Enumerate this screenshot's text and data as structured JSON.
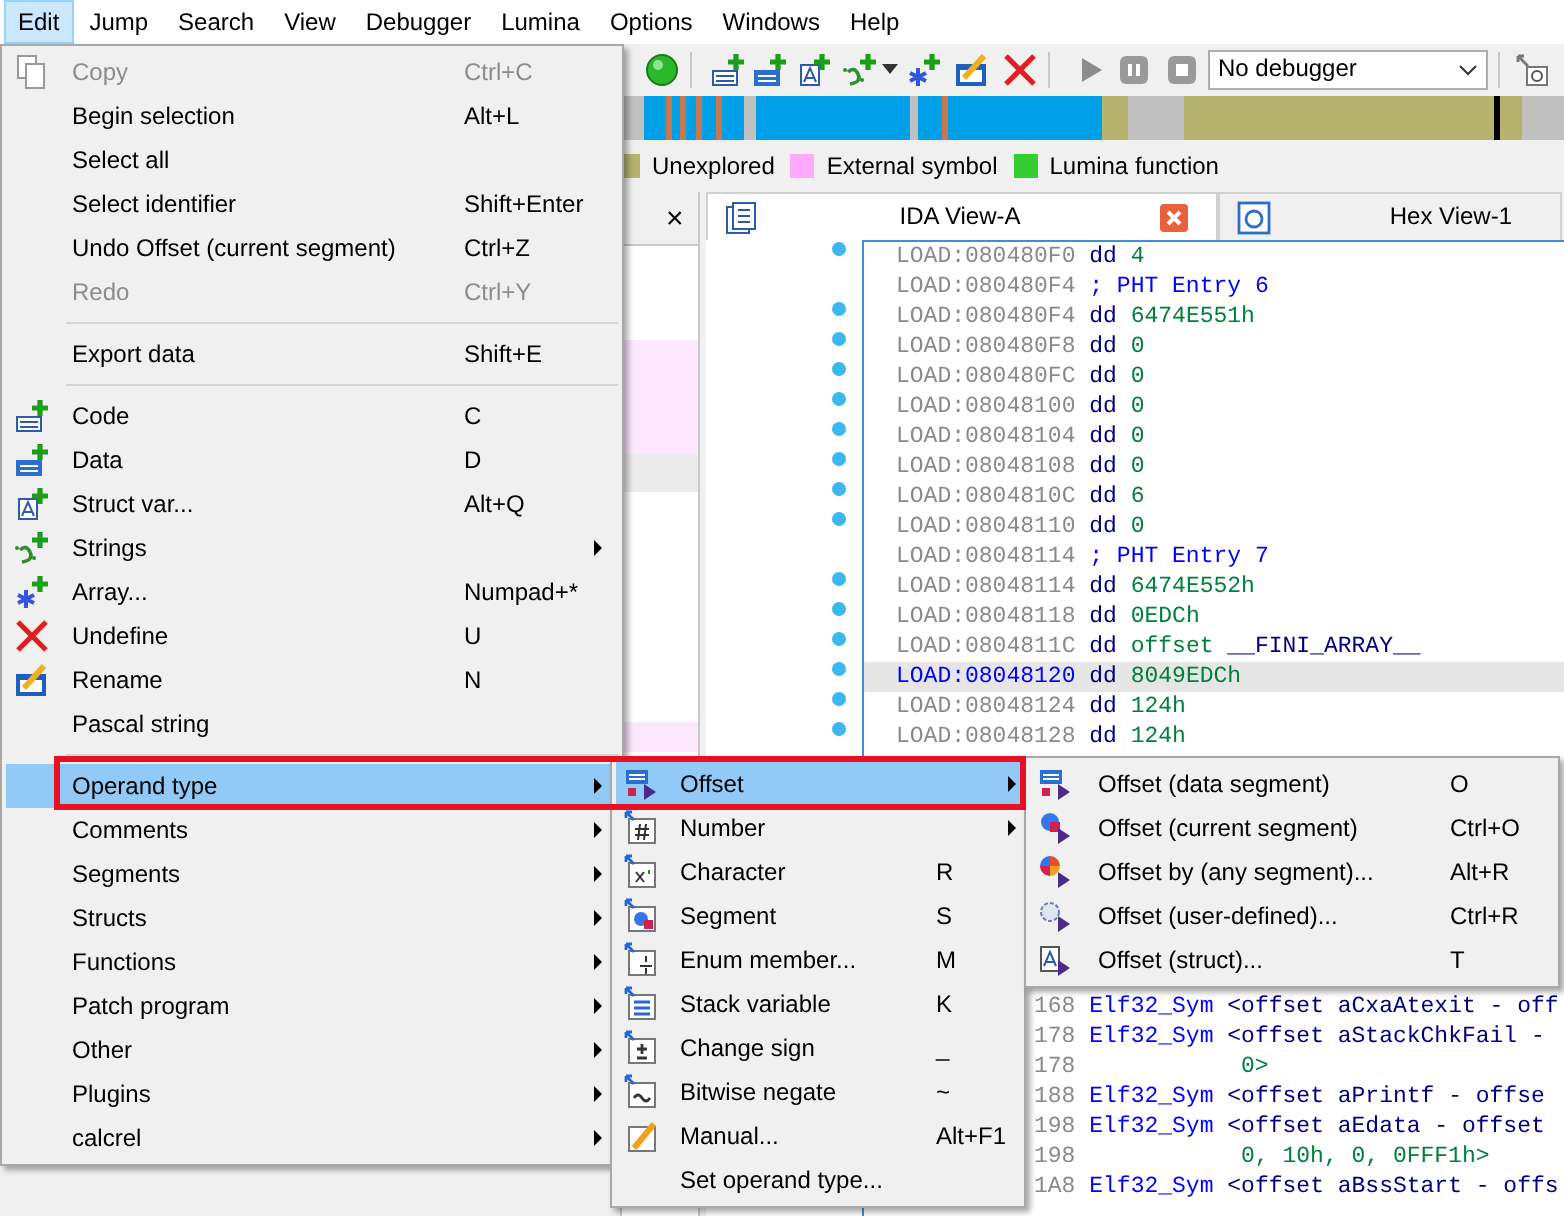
{
  "menu_bar": [
    {
      "label": "Edit",
      "selected": true
    },
    {
      "label": "Jump",
      "selected": false
    },
    {
      "label": "Search",
      "selected": false
    },
    {
      "label": "View",
      "selected": false
    },
    {
      "label": "Debugger",
      "selected": false
    },
    {
      "label": "Lumina",
      "selected": false
    },
    {
      "label": "Options",
      "selected": false
    },
    {
      "label": "Windows",
      "selected": false
    },
    {
      "label": "Help",
      "selected": false
    }
  ],
  "toolbar": {
    "debugger": "No debugger"
  },
  "legend": [
    {
      "label": "Unexplored",
      "color": "#b5b36e"
    },
    {
      "label": "External symbol",
      "color": "#ffaaff"
    },
    {
      "label": "Lumina function",
      "color": "#33cc33"
    }
  ],
  "left_panel": {
    "close": "×"
  },
  "tabs": [
    {
      "label": "IDA View-A",
      "selected": true
    },
    {
      "label": "Hex View-1",
      "selected": false
    }
  ],
  "listing": [
    {
      "kind": "data",
      "address": "LOAD:080480F0",
      "mnemonic": "dd",
      "operand": "4",
      "dot": true,
      "selected": false
    },
    {
      "kind": "comment",
      "address": "LOAD:080480F4",
      "comment": "; PHT Entry 6",
      "dot": false,
      "selected": false
    },
    {
      "kind": "data",
      "address": "LOAD:080480F4",
      "mnemonic": "dd",
      "operand": "6474E551h",
      "dot": true,
      "selected": false
    },
    {
      "kind": "data",
      "address": "LOAD:080480F8",
      "mnemonic": "dd",
      "operand": "0",
      "dot": true,
      "selected": false
    },
    {
      "kind": "data",
      "address": "LOAD:080480FC",
      "mnemonic": "dd",
      "operand": "0",
      "dot": true,
      "selected": false
    },
    {
      "kind": "data",
      "address": "LOAD:08048100",
      "mnemonic": "dd",
      "operand": "0",
      "dot": true,
      "selected": false
    },
    {
      "kind": "data",
      "address": "LOAD:08048104",
      "mnemonic": "dd",
      "operand": "0",
      "dot": true,
      "selected": false
    },
    {
      "kind": "data",
      "address": "LOAD:08048108",
      "mnemonic": "dd",
      "operand": "0",
      "dot": true,
      "selected": false
    },
    {
      "kind": "data",
      "address": "LOAD:0804810C",
      "mnemonic": "dd",
      "operand": "6",
      "dot": true,
      "selected": false
    },
    {
      "kind": "data",
      "address": "LOAD:08048110",
      "mnemonic": "dd",
      "operand": "0",
      "dot": true,
      "selected": false
    },
    {
      "kind": "comment",
      "address": "LOAD:08048114",
      "comment": "; PHT Entry 7",
      "dot": false,
      "selected": false
    },
    {
      "kind": "data",
      "address": "LOAD:08048114",
      "mnemonic": "dd",
      "operand": "6474E552h",
      "dot": true,
      "selected": false
    },
    {
      "kind": "data",
      "address": "LOAD:08048118",
      "mnemonic": "dd",
      "operand": "0EDCh",
      "dot": true,
      "selected": false
    },
    {
      "kind": "data",
      "address": "LOAD:0804811C",
      "mnemonic": "dd",
      "operand": "offset",
      "symbol": "__FINI_ARRAY__",
      "dot": true,
      "selected": false
    },
    {
      "kind": "data",
      "address": "LOAD:08048120",
      "mnemonic": "dd",
      "operand": "8049EDCh",
      "dot": true,
      "selected": true
    },
    {
      "kind": "data",
      "address": "LOAD:08048124",
      "mnemonic": "dd",
      "operand": "124h",
      "dot": true,
      "selected": false
    },
    {
      "kind": "data",
      "address": "LOAD:08048128",
      "mnemonic": "dd",
      "operand": "124h",
      "dot": true,
      "selected": false
    }
  ],
  "listing_tail": [
    {
      "kind": "struct",
      "address": "168",
      "type": "Elf32_Sym",
      "operand": "<offset aCxaAtexit - off"
    },
    {
      "kind": "struct",
      "address": "178",
      "type": "Elf32_Sym",
      "operand": "<offset aStackChkFail -"
    },
    {
      "kind": "continuation",
      "address": "178",
      "operand": "0>"
    },
    {
      "kind": "struct",
      "address": "188",
      "type": "Elf32_Sym",
      "operand": "<offset aPrintf - offse"
    },
    {
      "kind": "struct",
      "address": "198",
      "type": "Elf32_Sym",
      "operand": "<offset aEdata - offset"
    },
    {
      "kind": "continuation",
      "address": "198",
      "operand": "0, 10h, 0, 0FFF1h>"
    },
    {
      "kind": "struct",
      "address": "1A8",
      "type": "Elf32_Sym",
      "operand": "<offset aBssStart - offs"
    }
  ],
  "edit_menu": {
    "items": [
      {
        "kind": "item",
        "label": "Copy",
        "shortcut": "Ctrl+C",
        "disabled": true,
        "selected": false,
        "submenu": false
      },
      {
        "kind": "item",
        "label": "Begin selection",
        "shortcut": "Alt+L",
        "disabled": false,
        "selected": false,
        "submenu": false
      },
      {
        "kind": "item",
        "label": "Select all",
        "disabled": false,
        "selected": false,
        "submenu": false
      },
      {
        "kind": "item",
        "label": "Select identifier",
        "shortcut": "Shift+Enter",
        "disabled": false,
        "selected": false,
        "submenu": false
      },
      {
        "kind": "item",
        "label": "Undo Offset (current segment)",
        "shortcut": "Ctrl+Z",
        "disabled": false,
        "selected": false,
        "submenu": false
      },
      {
        "kind": "item",
        "label": "Redo",
        "shortcut": "Ctrl+Y",
        "disabled": true,
        "selected": false,
        "submenu": false
      },
      {
        "kind": "separator"
      },
      {
        "kind": "item",
        "label": "Export data",
        "shortcut": "Shift+E",
        "disabled": false,
        "selected": false,
        "submenu": false
      },
      {
        "kind": "separator"
      },
      {
        "kind": "item",
        "label": "Code",
        "shortcut": "C",
        "disabled": false,
        "selected": false,
        "submenu": false
      },
      {
        "kind": "item",
        "label": "Data",
        "shortcut": "D",
        "disabled": false,
        "selected": false,
        "submenu": false
      },
      {
        "kind": "item",
        "label": "Struct var...",
        "shortcut": "Alt+Q",
        "disabled": false,
        "selected": false,
        "submenu": false
      },
      {
        "kind": "item",
        "label": "Strings",
        "disabled": false,
        "selected": false,
        "submenu": true
      },
      {
        "kind": "item",
        "label": "Array...",
        "shortcut": "Numpad+*",
        "disabled": false,
        "selected": false,
        "submenu": false
      },
      {
        "kind": "item",
        "label": "Undefine",
        "shortcut": "U",
        "disabled": false,
        "selected": false,
        "submenu": false
      },
      {
        "kind": "item",
        "label": "Rename",
        "shortcut": "N",
        "disabled": false,
        "selected": false,
        "submenu": false
      },
      {
        "kind": "item",
        "label": "Pascal string",
        "disabled": false,
        "selected": false,
        "submenu": false
      },
      {
        "kind": "separator"
      },
      {
        "kind": "item",
        "label": "Operand type",
        "disabled": false,
        "selected": true,
        "submenu": true
      },
      {
        "kind": "item",
        "label": "Comments",
        "disabled": false,
        "selected": false,
        "submenu": true
      },
      {
        "kind": "item",
        "label": "Segments",
        "disabled": false,
        "selected": false,
        "submenu": true
      },
      {
        "kind": "item",
        "label": "Structs",
        "disabled": false,
        "selected": false,
        "submenu": true
      },
      {
        "kind": "item",
        "label": "Functions",
        "disabled": false,
        "selected": false,
        "submenu": true
      },
      {
        "kind": "item",
        "label": "Patch program",
        "disabled": false,
        "selected": false,
        "submenu": true
      },
      {
        "kind": "item",
        "label": "Other",
        "disabled": false,
        "selected": false,
        "submenu": true
      },
      {
        "kind": "item",
        "label": "Plugins",
        "disabled": false,
        "selected": false,
        "submenu": true
      },
      {
        "kind": "item",
        "label": "calcrel",
        "disabled": false,
        "selected": false,
        "submenu": true
      }
    ]
  },
  "operand_type_menu": {
    "items": [
      {
        "kind": "item",
        "label": "Offset",
        "disabled": false,
        "selected": true,
        "submenu": true
      },
      {
        "kind": "item",
        "label": "Number",
        "disabled": false,
        "selected": false,
        "submenu": true
      },
      {
        "kind": "item",
        "label": "Character",
        "shortcut": "R",
        "disabled": false,
        "selected": false,
        "submenu": false
      },
      {
        "kind": "item",
        "label": "Segment",
        "shortcut": "S",
        "disabled": false,
        "selected": false,
        "submenu": false
      },
      {
        "kind": "item",
        "label": "Enum member...",
        "shortcut": "M",
        "disabled": false,
        "selected": false,
        "submenu": false
      },
      {
        "kind": "item",
        "label": "Stack variable",
        "shortcut": "K",
        "disabled": false,
        "selected": false,
        "submenu": false
      },
      {
        "kind": "item",
        "label": "Change sign",
        "shortcut": "_",
        "disabled": false,
        "selected": false,
        "submenu": false
      },
      {
        "kind": "item",
        "label": "Bitwise negate",
        "shortcut": "~",
        "disabled": false,
        "selected": false,
        "submenu": false
      },
      {
        "kind": "item",
        "label": "Manual...",
        "shortcut": "Alt+F1",
        "disabled": false,
        "selected": false,
        "submenu": false
      },
      {
        "kind": "item",
        "label": "Set operand type...",
        "disabled": false,
        "selected": false,
        "submenu": false
      }
    ]
  },
  "offset_menu": {
    "items": [
      {
        "kind": "item",
        "label": "Offset (data segment)",
        "shortcut": "O",
        "disabled": false,
        "selected": false,
        "submenu": false
      },
      {
        "kind": "item",
        "label": "Offset (current segment)",
        "shortcut": "Ctrl+O",
        "disabled": false,
        "selected": false,
        "submenu": false
      },
      {
        "kind": "item",
        "label": "Offset by (any segment)...",
        "shortcut": "Alt+R",
        "disabled": false,
        "selected": false,
        "submenu": false
      },
      {
        "kind": "item",
        "label": "Offset (user-defined)...",
        "shortcut": "Ctrl+R",
        "disabled": false,
        "selected": false,
        "submenu": false
      },
      {
        "kind": "item",
        "label": "Offset (struct)...",
        "shortcut": "T",
        "disabled": false,
        "selected": false,
        "submenu": false
      }
    ]
  }
}
